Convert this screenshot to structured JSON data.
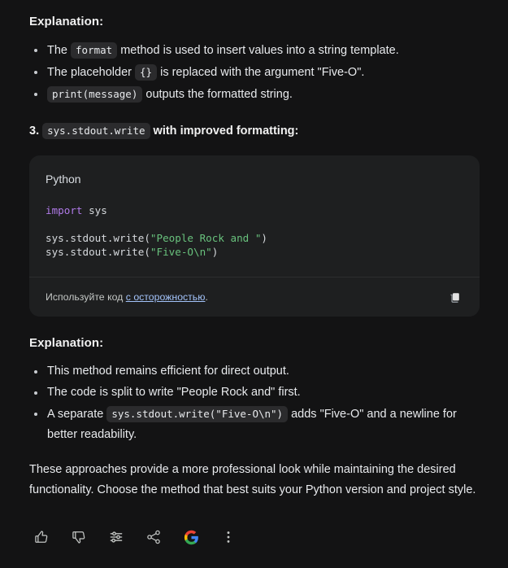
{
  "theme": {
    "page_bg": "#131314",
    "code_bg": "#1e1f20",
    "chip_bg": "#2b2b2d",
    "text": "#e8eaed",
    "link": "#a3c3fa",
    "string_color": "#69c27d",
    "keyword_color": "#b07ae8"
  },
  "explanation_top": {
    "heading": "Explanation:",
    "items": [
      {
        "pre": "The ",
        "code": "format",
        "post": " method is used to insert values into a string template."
      },
      {
        "pre": "The placeholder ",
        "code": "{}",
        "post": " is replaced with the argument \"Five-O\"."
      },
      {
        "pre": "",
        "code": "print(message)",
        "post": " outputs the formatted string."
      }
    ]
  },
  "ordered_item": {
    "number": "3.",
    "code": "sys.stdout.write",
    "tail": " with improved formatting:"
  },
  "code_block": {
    "language_label": "Python",
    "lines": [
      [
        {
          "t": "kw",
          "v": "import"
        },
        {
          "t": "plain",
          "v": " sys"
        }
      ],
      [
        {
          "t": "plain",
          "v": ""
        }
      ],
      [
        {
          "t": "plain",
          "v": "sys.stdout.write"
        },
        {
          "t": "punc",
          "v": "("
        },
        {
          "t": "str",
          "v": "\"People Rock and \""
        },
        {
          "t": "punc",
          "v": ")"
        }
      ],
      [
        {
          "t": "plain",
          "v": "sys.stdout.write"
        },
        {
          "t": "punc",
          "v": "("
        },
        {
          "t": "str",
          "v": "\"Five-O\\n\""
        },
        {
          "t": "punc",
          "v": ")"
        }
      ]
    ],
    "footer": {
      "note_prefix": "Используйте код ",
      "note_link": "с осторожностью",
      "note_suffix": ".",
      "copy_icon": "copy-icon"
    }
  },
  "explanation_bottom": {
    "heading": "Explanation:",
    "items": [
      {
        "pre": "This method remains efficient for direct output.",
        "code": "",
        "post": ""
      },
      {
        "pre": "The code is split to write \"People Rock and\" first.",
        "code": "",
        "post": ""
      },
      {
        "pre": "A separate ",
        "code": "sys.stdout.write(\"Five-O\\n\")",
        "post": " adds \"Five-O\" and a newline for better readability."
      }
    ]
  },
  "closing_paragraph": "These approaches provide a more professional look while maintaining the desired functionality. Choose the method that best suits your Python version and project style.",
  "actions": [
    {
      "name": "thumb-up-icon",
      "label": "Good response"
    },
    {
      "name": "thumb-down-icon",
      "label": "Bad response"
    },
    {
      "name": "sliders-icon",
      "label": "Modify response"
    },
    {
      "name": "share-icon",
      "label": "Share & export"
    },
    {
      "name": "google-logo-icon",
      "label": "Google it"
    },
    {
      "name": "more-vert-icon",
      "label": "More"
    }
  ]
}
